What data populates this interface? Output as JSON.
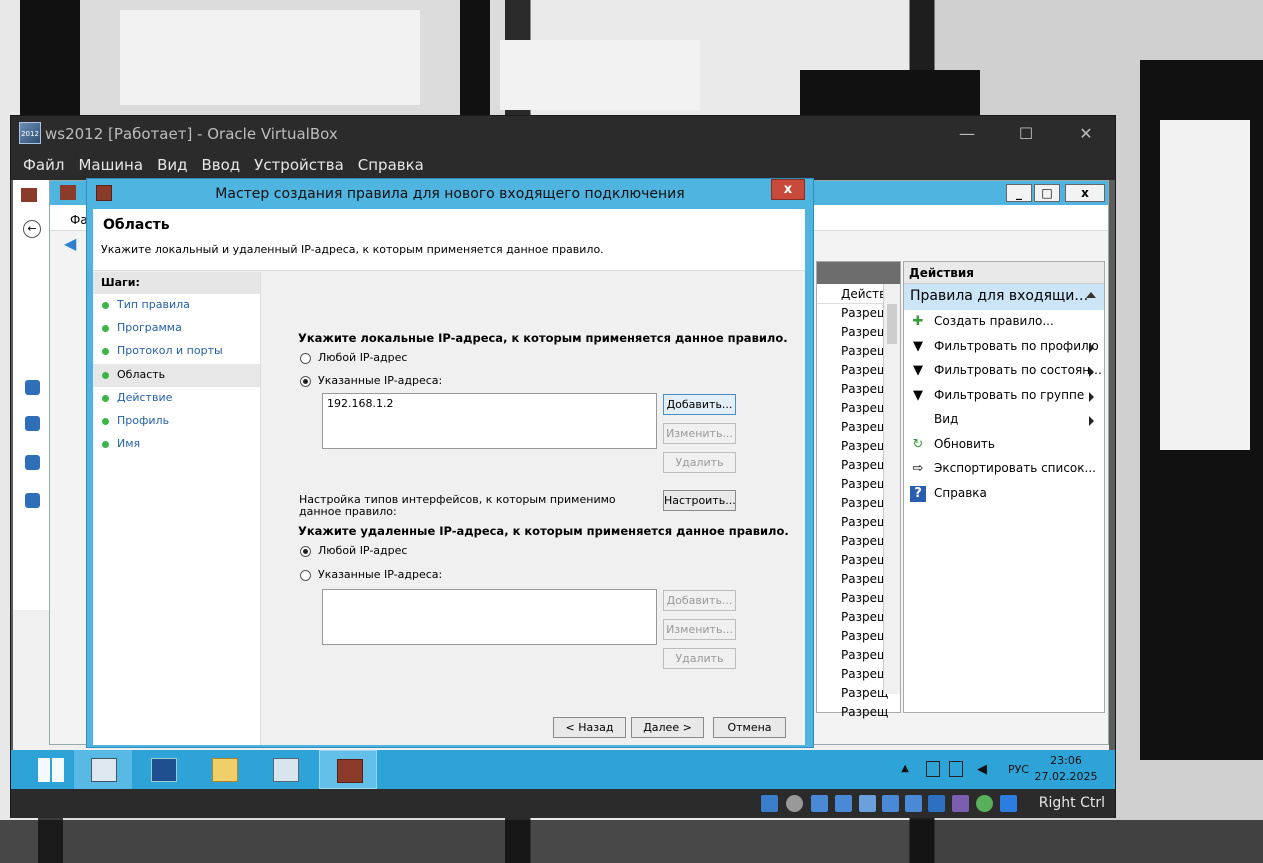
{
  "vbox": {
    "title": "ws2012 [Работает] - Oracle VirtualBox",
    "icon_label": "2012",
    "controls": {
      "minimize": "—",
      "maximize": "☐",
      "close": "✕"
    },
    "menu": [
      "Файл",
      "Машина",
      "Вид",
      "Ввод",
      "Устройства",
      "Справка"
    ],
    "host_key": "Right Ctrl"
  },
  "mmc": {
    "menu_first": "Фа",
    "column_header": "Действ",
    "rows": [
      "Разрещ",
      "Разрещ",
      "Разрещ",
      "Разрещ",
      "Разрещ",
      "Разрещ",
      "Разрещ",
      "Разрещ",
      "Разрещ",
      "Разрещ",
      "Разрещ",
      "Разрещ",
      "Разрещ",
      "Разрещ",
      "Разрещ",
      "Разрещ",
      "Разрещ",
      "Разрещ",
      "Разрещ",
      "Разрещ",
      "Разрещ",
      "Разрещ"
    ],
    "actions": {
      "header": "Действия",
      "group": "Правила для входящи…",
      "items": [
        {
          "label": "Создать правило...",
          "icon": "new-rule-icon",
          "submenu": false
        },
        {
          "label": "Фильтровать по профилю",
          "icon": "filter-icon",
          "submenu": true
        },
        {
          "label": "Фильтровать по состоян…",
          "icon": "filter-icon",
          "submenu": true
        },
        {
          "label": "Фильтровать по группе",
          "icon": "filter-icon",
          "submenu": true
        },
        {
          "label": "Вид",
          "icon": "",
          "submenu": true
        },
        {
          "label": "Обновить",
          "icon": "refresh-icon",
          "submenu": false
        },
        {
          "label": "Экспортировать список...",
          "icon": "export-icon",
          "submenu": false
        },
        {
          "label": "Справка",
          "icon": "help-icon",
          "submenu": false
        }
      ]
    }
  },
  "wizard": {
    "title": "Мастер создания правила для нового входящего подключения",
    "close": "x",
    "heading": "Область",
    "description": "Укажите локальный и удаленный IP-адреса, к которым применяется данное правило.",
    "steps_header": "Шаги:",
    "steps": [
      "Тип правила",
      "Программа",
      "Протокол и порты",
      "Область",
      "Действие",
      "Профиль",
      "Имя"
    ],
    "current_step": 3,
    "local": {
      "label": "Укажите локальные IP-адреса, к которым применяется данное правило.",
      "any": "Любой IP-адрес",
      "specified": "Указанные IP-адреса:",
      "selected": "specified",
      "list": [
        "192.168.1.2"
      ]
    },
    "interfaces_label": "Настройка типов интерфейсов, к которым применимо данное правило:",
    "remote": {
      "label": "Укажите удаленные IP-адреса, к которым применяется данное правило.",
      "any": "Любой IP-адрес",
      "specified": "Указанные IP-адреса:",
      "selected": "any",
      "list": []
    },
    "buttons": {
      "add": "Добавить...",
      "edit": "Изменить...",
      "remove": "Удалить",
      "customize": "Настроить...",
      "back": "< Назад",
      "next": "Далее >",
      "cancel": "Отмена"
    }
  },
  "taskbar": {
    "language": "РУС",
    "time": "23:06",
    "date": "27.02.2025"
  }
}
